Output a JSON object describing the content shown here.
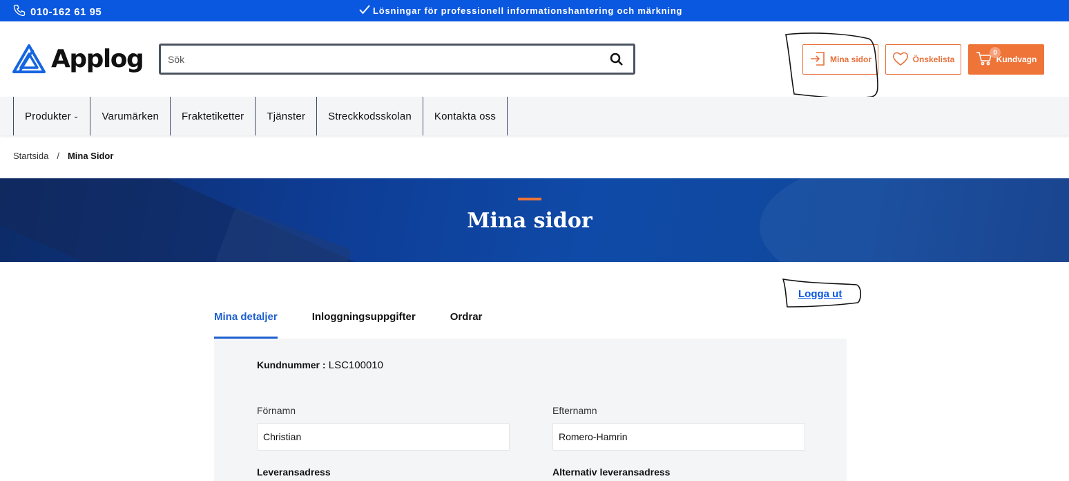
{
  "topbar": {
    "phone": "010-162 61 95",
    "tagline": "Lösningar för professionell informationshantering och märkning"
  },
  "header": {
    "logo_text": "Applog",
    "search_placeholder": "Sök",
    "buttons": {
      "mina_sidor": "Mina sidor",
      "wishlist": "Önskelista",
      "cart": "Kundvagn",
      "cart_count": "0"
    }
  },
  "nav": {
    "items": [
      "Produkter",
      "Varumärken",
      "Fraktetiketter",
      "Tjänster",
      "Streckkodsskolan",
      "Kontakta oss"
    ]
  },
  "breadcrumb": {
    "home": "Startsida",
    "separator": "/",
    "current": "Mina Sidor"
  },
  "hero": {
    "title": "Mina sidor"
  },
  "account": {
    "logout": "Logga ut",
    "tabs": [
      "Mina detaljer",
      "Inloggningsuppgifter",
      "Ordrar"
    ],
    "active_tab": "Mina detaljer",
    "customer_number_label": "Kundnummer :",
    "customer_number": "LSC100010",
    "first_name_label": "Förnamn",
    "first_name": "Christian",
    "last_name_label": "Efternamn",
    "last_name": "Romero-Hamrin",
    "delivery_address_label": "Leveransadress",
    "alt_delivery_address_label": "Alternativ leveransadress"
  },
  "colors": {
    "topbar": "#0a57e0",
    "accent_orange": "#ef7437",
    "active_tab": "#1d5fcf",
    "panel_bg": "#f4f5f7"
  }
}
